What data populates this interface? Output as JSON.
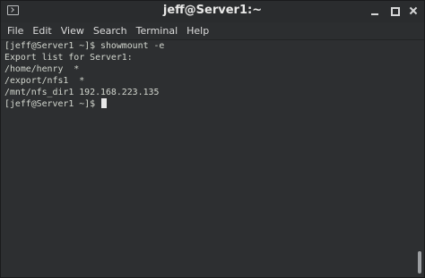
{
  "window": {
    "title": "jeff@Server1:~",
    "icon": "terminal-icon"
  },
  "menubar": {
    "items": [
      "File",
      "Edit",
      "View",
      "Search",
      "Terminal",
      "Help"
    ]
  },
  "terminal": {
    "lines": [
      "[jeff@Server1 ~]$ showmount -e",
      "Export list for Server1:",
      "/home/henry  *",
      "/export/nfs1  *",
      "/mnt/nfs_dir1 192.168.223.135",
      "[jeff@Server1 ~]$ "
    ],
    "colors": {
      "background": "#2d2f31",
      "foreground": "#d3d7cf",
      "cursor": "#e8e8e8"
    }
  }
}
